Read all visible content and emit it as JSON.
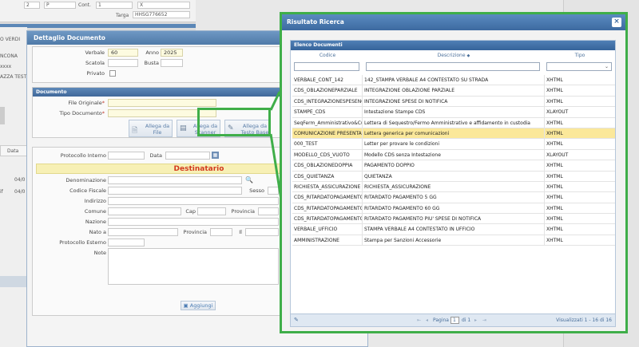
{
  "background": {
    "top_fields": {
      "f1": "2",
      "f2": "P",
      "cont_label": "Cont.",
      "cont_value": "1",
      "f3": "X",
      "targa_label": "Targa",
      "targa_value": "HHSG776652"
    },
    "left_texts": [
      "O VERDI",
      "NCONA",
      "xxxx",
      "AZZA TEST"
    ],
    "tab_labels": [
      "Data"
    ],
    "row_texts": [
      "04/0",
      "04/0"
    ],
    "left_stub": "if"
  },
  "dettaglio": {
    "title": "Dettaglio Documento",
    "verbale_label": "Verbale",
    "verbale_value": "60",
    "anno_label": "Anno",
    "anno_value": "2025",
    "scatola_label": "Scatola",
    "busta_label": "Busta",
    "privato_label": "Privato",
    "documento_section": "Documento",
    "file_originale_label": "File Originale",
    "tipo_documento_label": "Tipo Documento",
    "required_mark": "*",
    "btn_allega_file": "Allega da File",
    "btn_allega_scanner": "Allega da Scanner",
    "btn_allega_testo": "Allega da Testo Base",
    "protocollo_interno_label": "Protocollo Interno",
    "data_label": "Data",
    "destinatario": "Destinatario",
    "denominazione_label": "Denominazione",
    "codice_fiscale_label": "Codice Fiscale",
    "sesso_label": "Sesso",
    "indirizzo_label": "Indirizzo",
    "comune_label": "Comune",
    "cap_label": "Cap",
    "provincia_label": "Provincia",
    "nazione_label": "Nazione",
    "nato_a_label": "Nato a",
    "provincia2_label": "Provincia",
    "il_label": "Il",
    "protocollo_esterno_label": "Protocollo Esterno",
    "note_label": "Note",
    "aggiungi_label": "Aggiungi"
  },
  "risultato": {
    "title": "Risultato Ricerca",
    "close": "×",
    "grid_title": "Elenco Documenti",
    "columns": {
      "codice": "Codice",
      "descrizione": "Descrizione",
      "tipo": "Tipo",
      "sort_mark": "◆"
    },
    "rows": [
      {
        "codice": "VERBALE_CONT_142",
        "descrizione": "142_STAMPA VERBALE A4 CONTESTATO SU STRADA",
        "tipo": "XHTML"
      },
      {
        "codice": "CDS_OBLAZIONEPARZIALE",
        "descrizione": "INTEGRAZIONE OBLAZIONE PARZIALE",
        "tipo": "XHTML"
      },
      {
        "codice": "CDS_INTEGRAZIONESPESENO",
        "descrizione": "INTEGRAZIONE SPESE DI NOTIFICA",
        "tipo": "XHTML"
      },
      {
        "codice": "STAMPE_CDS",
        "descrizione": "Intestazione Stampe CDS",
        "tipo": "XLAYOUT"
      },
      {
        "codice": "SeqFerm_Amministrativo&Cu",
        "descrizione": "Lettera di Sequestro/Fermo Amministrativo e affidamento in custodia",
        "tipo": "XHTML"
      },
      {
        "codice": "COMUNICAZIONE PRESENTAZ",
        "descrizione": "Lettera generica per comunicazioni",
        "tipo": "XHTML",
        "selected": true
      },
      {
        "codice": "000_TEST",
        "descrizione": "Letter per provare le condizioni",
        "tipo": "XHTML"
      },
      {
        "codice": "MODELLO_CDS_VUOTO",
        "descrizione": "Modello CDS senza Intestazione",
        "tipo": "XLAYOUT"
      },
      {
        "codice": "CDS_OBLAZIONEDOPPIA",
        "descrizione": "PAGAMENTO DOPPIO",
        "tipo": "XHTML"
      },
      {
        "codice": "CDS_QUIETANZA",
        "descrizione": "QUIETANZA",
        "tipo": "XHTML"
      },
      {
        "codice": "RICHIESTA_ASSICURAZIONE",
        "descrizione": "RICHIESTA_ASSICURAZIONE",
        "tipo": "XHTML"
      },
      {
        "codice": "CDS_RITARDATOPAGAMENTO",
        "descrizione": "RITARDATO PAGAMENTO 5 GG",
        "tipo": "XHTML"
      },
      {
        "codice": "CDS_RITARDATOPAGAMENTO",
        "descrizione": "RITARDATO PAGAMENTO 60 GG",
        "tipo": "XHTML"
      },
      {
        "codice": "CDS_RITARDATOPAGAMENTO",
        "descrizione": "RITARDATO PAGAMENTO PIU' SPESE DI NOTIFICA",
        "tipo": "XHTML"
      },
      {
        "codice": "VERBALE_UFFICIO",
        "descrizione": "STAMPA VERBALE A4 CONTESTATO IN UFFICIO",
        "tipo": "XHTML"
      },
      {
        "codice": "AMMINISTRAZIONE",
        "descrizione": "Stampa per Sanzioni Accessorie",
        "tipo": "XHTML"
      }
    ],
    "pager": {
      "pagina_label": "Pagina",
      "page_value": "1",
      "of_label": "di 1",
      "status": "Visualizzati 1 - 16 di 16"
    }
  },
  "colors": {
    "accent_blue": "#4f7fb5",
    "highlight": "#3fae49",
    "selected_row": "#fbe89a",
    "destinatario_text": "#d23a1e"
  }
}
